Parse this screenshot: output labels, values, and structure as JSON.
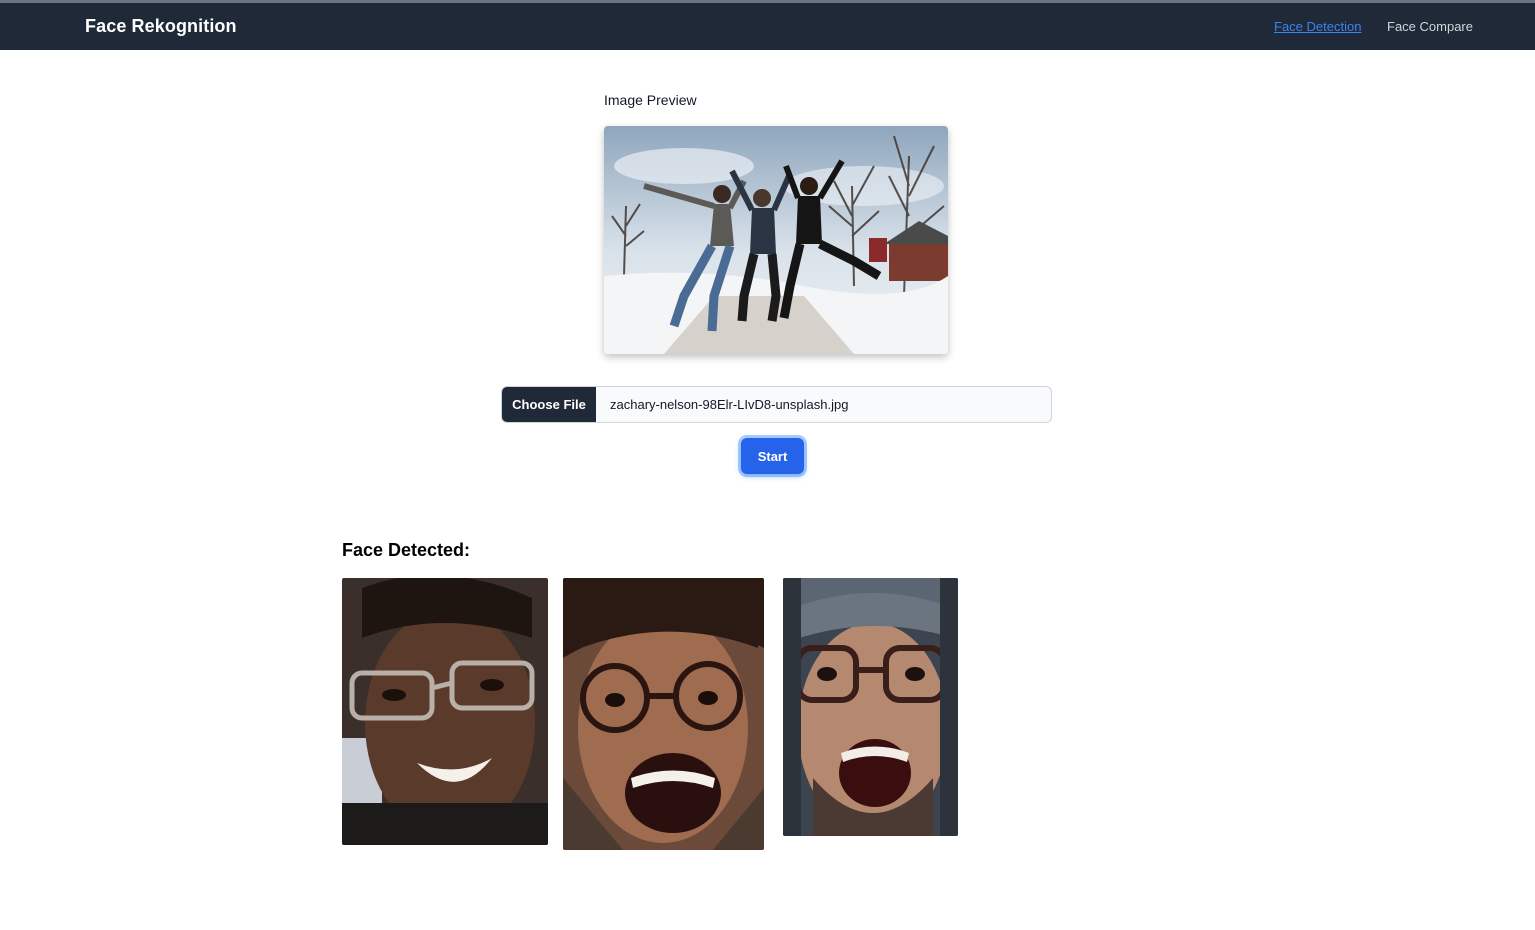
{
  "navbar": {
    "brand": "Face Rekognition",
    "links": [
      {
        "label": "Face Detection",
        "active": true
      },
      {
        "label": "Face Compare",
        "active": false
      }
    ]
  },
  "preview": {
    "label": "Image Preview",
    "image_alt": "Three people jumping in the snow"
  },
  "upload": {
    "button_label": "Choose File",
    "file_name": "zachary-nelson-98Elr-LIvD8-unsplash.jpg"
  },
  "actions": {
    "start_label": "Start"
  },
  "results": {
    "heading": "Face Detected:",
    "faces": [
      {
        "alt": "Detected face 1"
      },
      {
        "alt": "Detected face 2"
      },
      {
        "alt": "Detected face 3"
      }
    ]
  },
  "colors": {
    "navbar_bg": "#1f2937",
    "active_link": "#3b82f6",
    "primary_button": "#2563eb"
  }
}
